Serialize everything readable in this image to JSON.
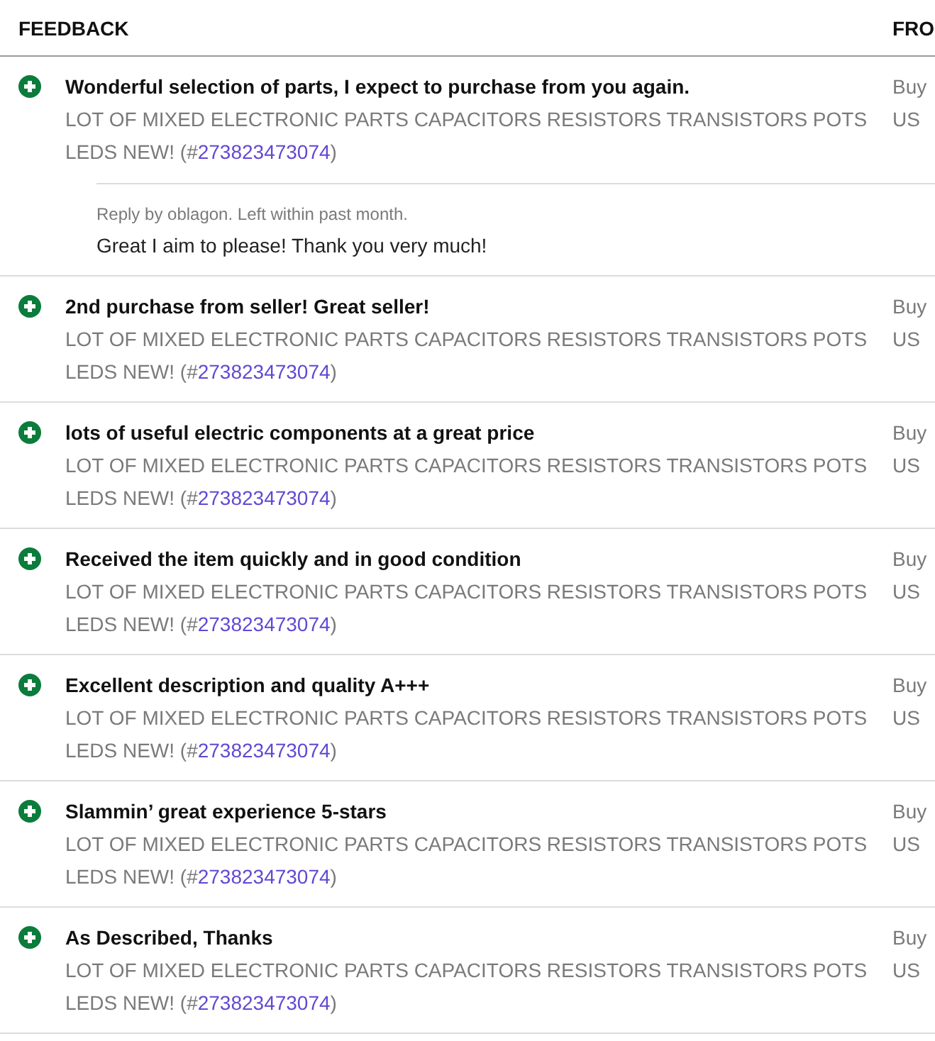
{
  "columns": [
    "FEEDBACK",
    "FRO"
  ],
  "rows": [
    {
      "kind": "positive",
      "comment": "Wonderful selection of parts, I expect to purchase from you again.",
      "item": {
        "text": "LOT OF MIXED ELECTRONIC PARTS CAPACITORS RESISTORS TRANSISTORS POTS LEDS NEW! (#",
        "link": "273823473074",
        "text_after": ")"
      },
      "column_2": [
        "Buy",
        "US"
      ],
      "reply": {
        "meta": "Reply by oblagon. Left within past month.",
        "text": "Great I aim to please! Thank you very much!"
      }
    },
    {
      "kind": "positive",
      "comment": "2nd purchase from seller! Great seller!",
      "item": {
        "text": "LOT OF MIXED ELECTRONIC PARTS CAPACITORS RESISTORS TRANSISTORS POTS LEDS NEW! (#",
        "link": "273823473074",
        "text_after": ")"
      },
      "column_2": [
        "Buy",
        "US"
      ]
    },
    {
      "kind": "positive",
      "comment": "lots of useful electric components at a great price",
      "item": {
        "text": "LOT OF MIXED ELECTRONIC PARTS CAPACITORS RESISTORS TRANSISTORS POTS LEDS NEW! (#",
        "link": "273823473074",
        "text_after": ")"
      },
      "column_2": [
        "Buy",
        "US"
      ]
    },
    {
      "kind": "positive",
      "comment": "Received the item quickly and in good condition",
      "item": {
        "text": "LOT OF MIXED ELECTRONIC PARTS CAPACITORS RESISTORS TRANSISTORS POTS LEDS NEW! (#",
        "link": "273823473074",
        "text_after": ")"
      },
      "column_2": [
        "Buy",
        "US"
      ]
    },
    {
      "kind": "positive",
      "comment": "Excellent description and quality A+++",
      "item": {
        "text": "LOT OF MIXED ELECTRONIC PARTS CAPACITORS RESISTORS TRANSISTORS POTS LEDS NEW! (#",
        "link": "273823473074",
        "text_after": ")"
      },
      "column_2": [
        "Buy",
        "US"
      ]
    },
    {
      "kind": "positive",
      "comment": "Slammin’ great experience 5-stars",
      "item": {
        "text": "LOT OF MIXED ELECTRONIC PARTS CAPACITORS RESISTORS TRANSISTORS POTS LEDS NEW! (#",
        "link": "273823473074",
        "text_after": ")"
      },
      "column_2": [
        "Buy",
        "US"
      ]
    },
    {
      "kind": "positive",
      "comment": "As Described, Thanks",
      "item": {
        "text": "LOT OF MIXED ELECTRONIC PARTS CAPACITORS RESISTORS TRANSISTORS POTS LEDS NEW! (#",
        "link": "273823473074",
        "text_after": ")"
      },
      "column_2": [
        "Buy",
        "US"
      ]
    }
  ]
}
